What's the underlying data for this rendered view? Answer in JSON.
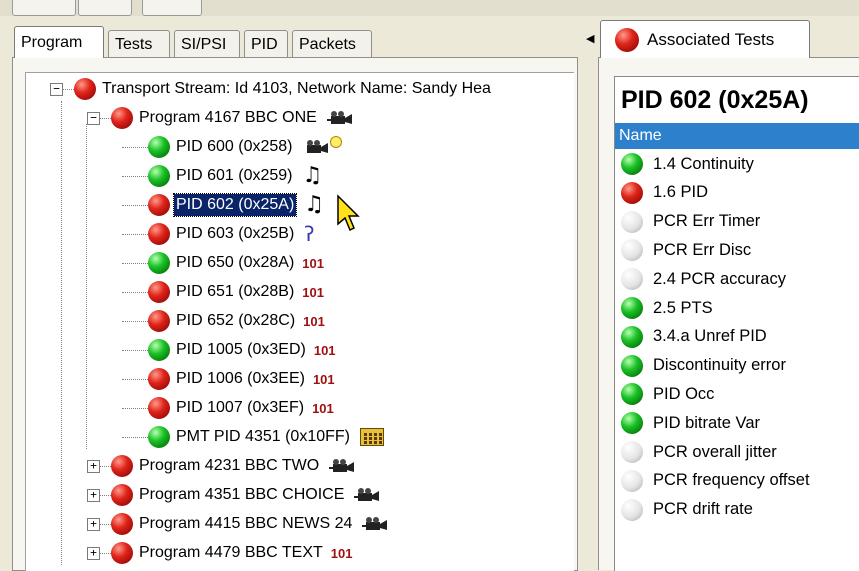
{
  "left_tabs": [
    "Program",
    "Tests",
    "SI/PSI",
    "PID",
    "Packets"
  ],
  "tree": [
    {
      "label": "Transport Stream: Id 4103, Network Name: Sandy Hea",
      "status": "red",
      "level": 0,
      "expander": "−"
    },
    {
      "label": "Program 4167 BBC ONE",
      "status": "red",
      "level": 1,
      "expander": "−",
      "icon": "camera-icon"
    },
    {
      "label": "PID 600 (0x258)",
      "status": "green",
      "level": 2,
      "icon": "camera-clock-icon"
    },
    {
      "label": "PID 601 (0x259)",
      "status": "green",
      "level": 2,
      "icon": "music-note-icon"
    },
    {
      "label": "PID 602 (0x25A)",
      "status": "red",
      "level": 2,
      "icon": "music-note-icon",
      "selected": true
    },
    {
      "label": "PID 603 (0x25B)",
      "status": "red",
      "level": 2,
      "icon": "ear-icon"
    },
    {
      "label": "PID 650 (0x28A)",
      "status": "green",
      "level": 2,
      "badge": "101"
    },
    {
      "label": "PID 651 (0x28B)",
      "status": "red",
      "level": 2,
      "badge": "101"
    },
    {
      "label": "PID 652 (0x28C)",
      "status": "red",
      "level": 2,
      "badge": "101"
    },
    {
      "label": "PID 1005 (0x3ED)",
      "status": "green",
      "level": 2,
      "badge": "101"
    },
    {
      "label": "PID 1006 (0x3EE)",
      "status": "red",
      "level": 2,
      "badge": "101"
    },
    {
      "label": "PID 1007 (0x3EF)",
      "status": "red",
      "level": 2,
      "badge": "101"
    },
    {
      "label": "PMT PID 4351 (0x10FF)",
      "status": "green",
      "level": 2,
      "icon": "calculator-icon"
    },
    {
      "label": "Program 4231 BBC TWO",
      "status": "red",
      "level": 1,
      "expander": "+",
      "icon": "camera-icon"
    },
    {
      "label": "Program 4351 BBC CHOICE",
      "status": "red",
      "level": 1,
      "expander": "+",
      "icon": "camera-icon"
    },
    {
      "label": "Program 4415 BBC NEWS 24",
      "status": "red",
      "level": 1,
      "expander": "+",
      "icon": "camera-icon"
    },
    {
      "label": "Program 4479 BBC TEXT",
      "status": "red",
      "level": 1,
      "expander": "+",
      "badge": "101"
    }
  ],
  "right_panel": {
    "tab_label": "Associated Tests",
    "pid_title": "PID 602 (0x25A)",
    "column_header": "Name",
    "tests": [
      {
        "name": "1.4 Continuity",
        "status": "green"
      },
      {
        "name": "1.6 PID",
        "status": "red"
      },
      {
        "name": "PCR Err Timer",
        "status": "grey"
      },
      {
        "name": "PCR Err Disc",
        "status": "grey"
      },
      {
        "name": "2.4 PCR accuracy",
        "status": "grey"
      },
      {
        "name": "2.5 PTS",
        "status": "green"
      },
      {
        "name": "3.4.a Unref PID",
        "status": "green"
      },
      {
        "name": "Discontinuity error",
        "status": "green"
      },
      {
        "name": "PID Occ",
        "status": "green"
      },
      {
        "name": "PID bitrate Var",
        "status": "green"
      },
      {
        "name": "PCR overall jitter",
        "status": "grey"
      },
      {
        "name": "PCR frequency offset",
        "status": "grey"
      },
      {
        "name": "PCR drift rate",
        "status": "grey"
      }
    ]
  },
  "colors": {
    "selection": "#0a246a",
    "column_header": "#2c80cc",
    "badge": "#a01010",
    "status_red": "#e0241a",
    "status_green": "#19c226",
    "status_grey": "#e4e4e4"
  }
}
